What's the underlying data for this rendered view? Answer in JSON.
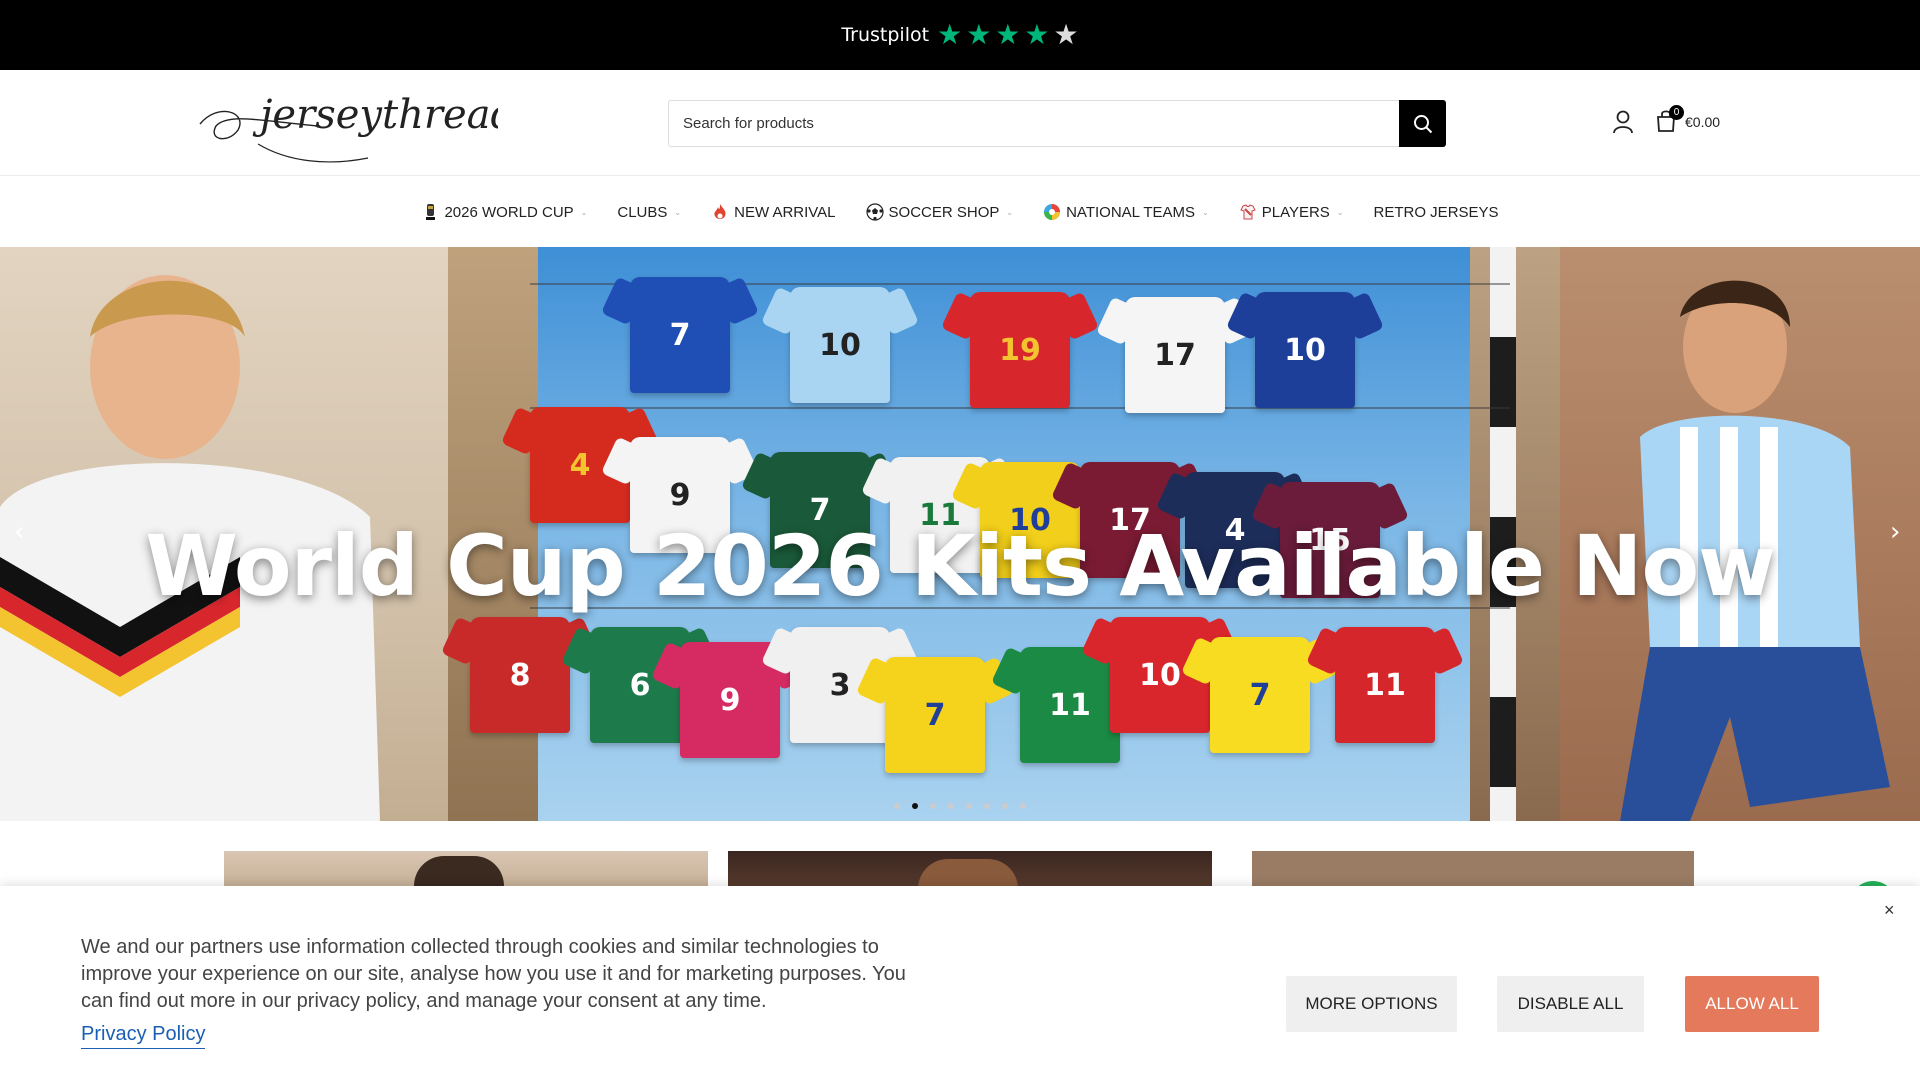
{
  "topbar": {
    "trustpilot_label": "Trustpilot",
    "rating_stars": 4,
    "max_stars": 5,
    "star_color": "#00b67a"
  },
  "header": {
    "logo_text": "jerseythread",
    "search_placeholder": "Search for products",
    "cart_count": "0",
    "cart_total": "€0.00"
  },
  "nav": {
    "items": [
      {
        "label": "2026 WORLD CUP",
        "icon": "trophy-icon",
        "has_dropdown": true
      },
      {
        "label": "CLUBS",
        "icon": "",
        "has_dropdown": true
      },
      {
        "label": "NEW ARRIVAL",
        "icon": "fire-icon",
        "has_dropdown": false
      },
      {
        "label": "SOCCER SHOP",
        "icon": "soccer-ball-icon",
        "has_dropdown": true
      },
      {
        "label": "NATIONAL TEAMS",
        "icon": "globe-icon",
        "has_dropdown": true
      },
      {
        "label": "PLAYERS",
        "icon": "jersey-icon",
        "has_dropdown": true
      },
      {
        "label": "RETRO JERSEYS",
        "icon": "",
        "has_dropdown": false
      }
    ],
    "chevron": "⌄"
  },
  "hero": {
    "title": "World Cup 2026 Kits Available Now",
    "prev_arrow": "‹",
    "next_arrow": "›",
    "slide_count": 8,
    "active_slide": 2,
    "shirt_numbers": [
      "7",
      "10",
      "19",
      "17",
      "10",
      "4",
      "9",
      "7",
      "11",
      "10",
      "17",
      "4",
      "15",
      "8",
      "6",
      "9",
      "3",
      "7",
      "11",
      "10",
      "7",
      "11"
    ]
  },
  "cookie": {
    "text": "We and our partners use information collected through cookies and similar technologies to improve your experience on our site, analyse how you use it and for marketing purposes. You can find out more in our privacy policy, and manage your consent at any time.",
    "privacy_link": "Privacy Policy",
    "more_options": "MORE OPTIONS",
    "disable_all": "DISABLE ALL",
    "allow_all": "ALLOW ALL",
    "close": "×",
    "accent_color": "#e47a5b"
  }
}
